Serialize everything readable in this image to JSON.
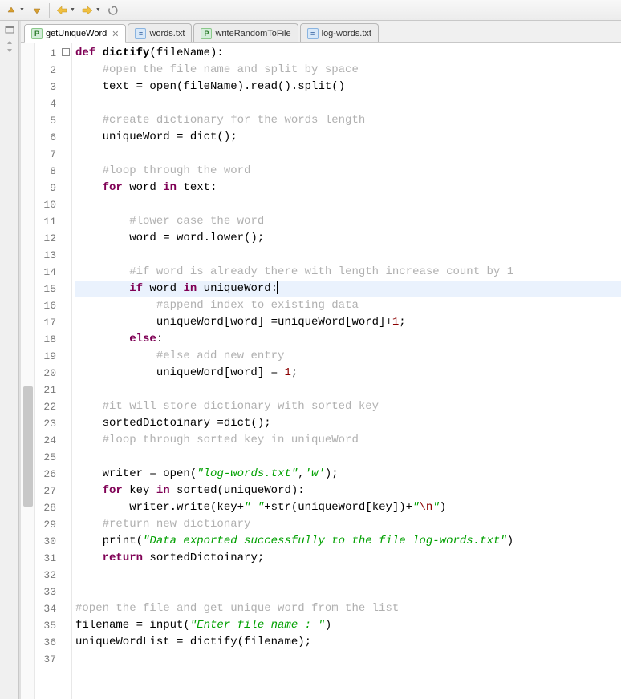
{
  "toolbar": {
    "icons": [
      "nav-up",
      "nav-down",
      "back",
      "forward",
      "refresh"
    ]
  },
  "tabs": [
    {
      "label": "getUniqueWord",
      "type": "py",
      "active": true,
      "closeable": true
    },
    {
      "label": "words.txt",
      "type": "txt",
      "active": false,
      "closeable": false
    },
    {
      "label": "writeRandomToFile",
      "type": "py",
      "active": false,
      "closeable": false
    },
    {
      "label": "log-words.txt",
      "type": "txt",
      "active": false,
      "closeable": false
    }
  ],
  "code": {
    "line_count": 37,
    "highlight_line": 15,
    "fold_marker_line": 1,
    "lines": {
      "l1": {
        "kw1": "def ",
        "fn": "dictify",
        "rest": "(fileName):"
      },
      "l2": {
        "indent": "    ",
        "cm": "#open the file name and split by space"
      },
      "l3": {
        "indent": "    ",
        "txt": "text = open(fileName).read().split()"
      },
      "l5": {
        "indent": "    ",
        "cm": "#create dictionary for the words length"
      },
      "l6": {
        "indent": "    ",
        "txt": "uniqueWord = dict();"
      },
      "l8": {
        "indent": "    ",
        "cm": "#loop through the word"
      },
      "l9": {
        "indent": "    ",
        "kw1": "for",
        "mid1": " word ",
        "kw2": "in",
        "mid2": " text:"
      },
      "l11": {
        "indent": "        ",
        "cm": "#lower case the word"
      },
      "l12": {
        "indent": "        ",
        "txt": "word = word.lower();"
      },
      "l14": {
        "indent": "        ",
        "cm": "#if word is already there with length increase count by 1"
      },
      "l15": {
        "indent": "        ",
        "kw1": "if",
        "mid1": " word ",
        "kw2": "in",
        "mid2": " uniqueWord:"
      },
      "l16": {
        "indent": "            ",
        "cm": "#append index to existing data"
      },
      "l17": {
        "indent": "            ",
        "pre": "uniqueWord[word] =uniqueWord[word]+",
        "num": "1",
        "post": ";"
      },
      "l18": {
        "indent": "        ",
        "kw1": "else",
        "rest": ":"
      },
      "l19": {
        "indent": "            ",
        "cm": "#else add new entry"
      },
      "l20": {
        "indent": "            ",
        "pre": "uniqueWord[word] = ",
        "num": "1",
        "post": ";"
      },
      "l22": {
        "indent": "    ",
        "cm": "#it will store dictionary with sorted key"
      },
      "l23": {
        "indent": "    ",
        "txt": "sortedDictoinary =dict();"
      },
      "l24": {
        "indent": "    ",
        "cm": "#loop through sorted key in uniqueWord"
      },
      "l26": {
        "indent": "    ",
        "pre": "writer = open(",
        "str1": "\"log-words.txt\"",
        "mid": ",",
        "str2": "'w'",
        "post": ");"
      },
      "l27": {
        "indent": "    ",
        "kw1": "for",
        "mid1": " key ",
        "kw2": "in",
        "mid2": " sorted(uniqueWord):"
      },
      "l28": {
        "indent": "        ",
        "pre": "writer.write(key+",
        "str1": "\" \"",
        "mid": "+str(uniqueWord[key])+",
        "str2": "\"",
        "esc": "\\n",
        "str3": "\"",
        "post": ")"
      },
      "l29": {
        "indent": "    ",
        "cm": "#return new dictionary"
      },
      "l30": {
        "indent": "    ",
        "pre": "print(",
        "str": "\"Data exported successfully to the file log-words.txt\"",
        "post": ")"
      },
      "l31": {
        "indent": "    ",
        "kw1": "return",
        "rest": " sortedDictoinary;"
      },
      "l34": {
        "cm": "#open the file and get unique word from the list"
      },
      "l35": {
        "pre": "filename = input(",
        "str": "\"Enter file name : \"",
        "post": ")"
      },
      "l36": {
        "txt": "uniqueWordList = dictify(filename);"
      }
    }
  }
}
